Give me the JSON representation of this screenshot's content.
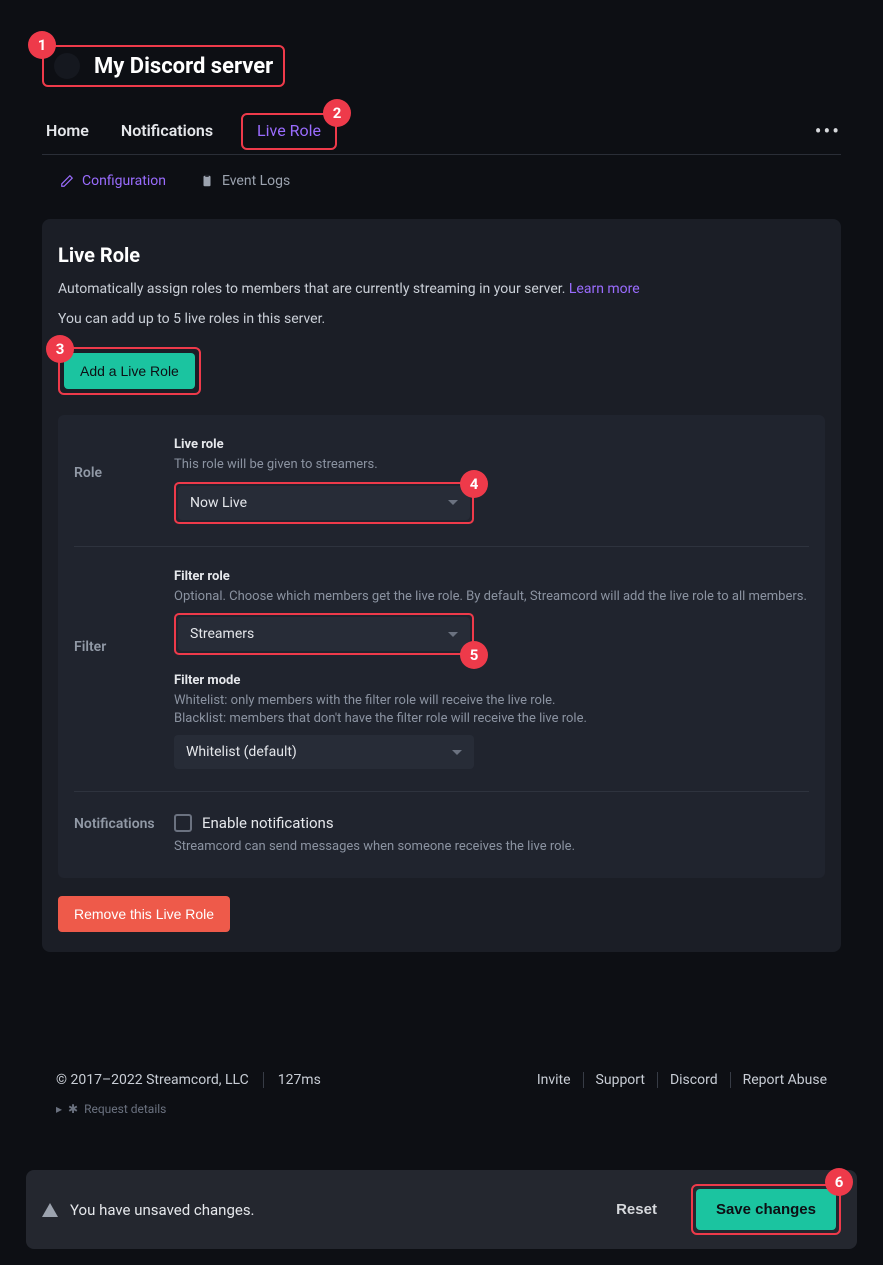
{
  "header": {
    "server_name": "My Discord server"
  },
  "tabs": {
    "home": "Home",
    "notifications": "Notifications",
    "live_role": "Live Role"
  },
  "subtabs": {
    "configuration": "Configuration",
    "event_logs": "Event Logs"
  },
  "card": {
    "title": "Live Role",
    "desc": "Automatically assign roles to members that are currently streaming in your server. ",
    "learn_more": "Learn more",
    "limit": "You can add up to 5 live roles in this server.",
    "add_btn": "Add a Live Role"
  },
  "role_section": {
    "label": "Role",
    "field_label": "Live role",
    "field_help": "This role will be given to streamers.",
    "value": "Now Live"
  },
  "filter_section": {
    "label": "Filter",
    "filter_role_label": "Filter role",
    "filter_role_help": "Optional. Choose which members get the live role. By default, Streamcord will add the live role to all members.",
    "filter_role_value": "Streamers",
    "filter_mode_label": "Filter mode",
    "filter_mode_help1": "Whitelist: only members with the filter role will receive the live role.",
    "filter_mode_help2": "Blacklist: members that don't have the filter role will receive the live role.",
    "filter_mode_value": "Whitelist (default)"
  },
  "notifications_section": {
    "label": "Notifications",
    "checkbox_label": "Enable notifications",
    "help": "Streamcord can send messages when someone receives the live role."
  },
  "remove_btn": "Remove this Live Role",
  "footer": {
    "copyright": "© 2017–2022 Streamcord, LLC",
    "latency": "127ms",
    "links": {
      "invite": "Invite",
      "support": "Support",
      "discord": "Discord",
      "report": "Report Abuse"
    },
    "request_details": "Request details"
  },
  "toast": {
    "message": "You have unsaved changes.",
    "reset": "Reset",
    "save": "Save changes"
  },
  "badges": {
    "b1": "1",
    "b2": "2",
    "b3": "3",
    "b4": "4",
    "b5": "5",
    "b6": "6"
  }
}
